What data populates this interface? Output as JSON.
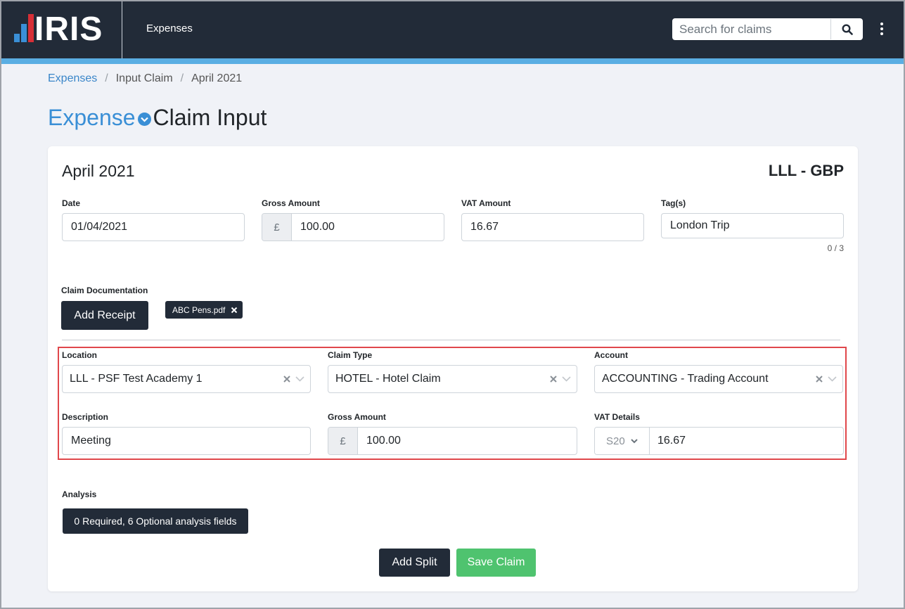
{
  "colors": {
    "header_bg": "#222b38",
    "accent": "#5aaee3",
    "link": "#3a86c9",
    "highlight": "#e0474b",
    "save_green": "#4fc36f",
    "logo_bar_1": "#3a8fd6",
    "logo_bar_2": "#d72e36"
  },
  "header": {
    "logo_text": "IRIS",
    "nav_label": "Expenses",
    "search_placeholder": "Search for claims",
    "search_icon": "search-icon",
    "menu_icon": "kebab-menu-icon"
  },
  "breadcrumb": {
    "items": [
      "Expenses",
      "Input Claim",
      "April 2021"
    ],
    "separator": "/"
  },
  "page": {
    "title_part1": "Expense",
    "title_part2": "Claim Input"
  },
  "claim": {
    "month": "April 2021",
    "currency": "LLL - GBP",
    "date_label": "Date",
    "date_value": "01/04/2021",
    "gross_label": "Gross Amount",
    "gross_symbol": "£",
    "gross_value": "100.00",
    "vat_label": "VAT Amount",
    "vat_value": "16.67",
    "tags_label": "Tag(s)",
    "tags_value": "London Trip",
    "tags_counter": "0 / 3"
  },
  "documentation": {
    "label": "Claim Documentation",
    "add_receipt": "Add Receipt",
    "file_name": "ABC Pens.pdf"
  },
  "split": {
    "location_label": "Location",
    "location_value": "LLL - PSF Test Academy 1",
    "claim_type_label": "Claim Type",
    "claim_type_value": "HOTEL - Hotel Claim",
    "account_label": "Account",
    "account_value": "ACCOUNTING - Trading Account",
    "description_label": "Description",
    "description_value": "Meeting",
    "gross_label": "Gross Amount",
    "gross_symbol": "£",
    "gross_value": "100.00",
    "vat_label": "VAT Details",
    "vat_code": "S20",
    "vat_value": "16.67"
  },
  "analysis": {
    "label": "Analysis",
    "button": "0 Required, 6 Optional analysis fields"
  },
  "actions": {
    "add_split": "Add Split",
    "save_claim": "Save Claim"
  }
}
